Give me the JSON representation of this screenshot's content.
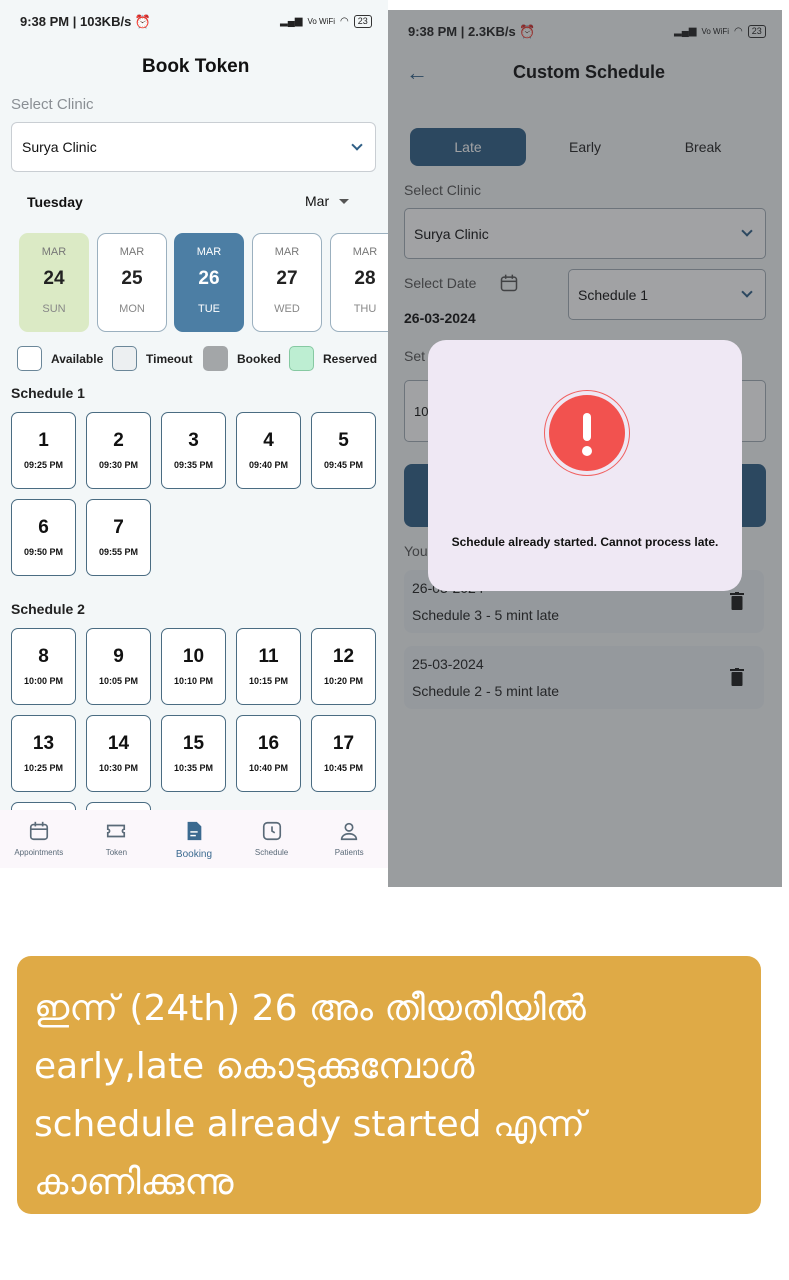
{
  "left_screen": {
    "status": {
      "time": "9:38 PM | 103KB/s ⏰",
      "signal": "Vo WiFi",
      "battery": "23"
    },
    "title": "Book Token",
    "select_clinic_label": "Select Clinic",
    "clinic_value": "Surya Clinic",
    "day_name": "Tuesday",
    "month_value": "Mar",
    "days": [
      {
        "month": "MAR",
        "date": "24",
        "weekday": "SUN"
      },
      {
        "month": "MAR",
        "date": "25",
        "weekday": "MON"
      },
      {
        "month": "MAR",
        "date": "26",
        "weekday": "TUE"
      },
      {
        "month": "MAR",
        "date": "27",
        "weekday": "WED"
      },
      {
        "month": "MAR",
        "date": "28",
        "weekday": "THU"
      }
    ],
    "legend": [
      {
        "label": "Available",
        "color": "#ffffff"
      },
      {
        "label": "Timeout",
        "color": "#eceff1"
      },
      {
        "label": "Booked",
        "color": "#a3a6a8"
      },
      {
        "label": "Reserved",
        "color": "#bdeed2"
      }
    ],
    "schedule1": {
      "title": "Schedule 1",
      "tokens": [
        {
          "num": "1",
          "time": "09:25 PM"
        },
        {
          "num": "2",
          "time": "09:30 PM"
        },
        {
          "num": "3",
          "time": "09:35 PM"
        },
        {
          "num": "4",
          "time": "09:40 PM"
        },
        {
          "num": "5",
          "time": "09:45 PM"
        },
        {
          "num": "6",
          "time": "09:50 PM"
        },
        {
          "num": "7",
          "time": "09:55 PM"
        }
      ]
    },
    "schedule2": {
      "title": "Schedule 2",
      "tokens": [
        {
          "num": "8",
          "time": "10:00 PM"
        },
        {
          "num": "9",
          "time": "10:05 PM"
        },
        {
          "num": "10",
          "time": "10:10 PM"
        },
        {
          "num": "11",
          "time": "10:15 PM"
        },
        {
          "num": "12",
          "time": "10:20 PM"
        },
        {
          "num": "13",
          "time": "10:25 PM"
        },
        {
          "num": "14",
          "time": "10:30 PM"
        },
        {
          "num": "15",
          "time": "10:35 PM"
        },
        {
          "num": "16",
          "time": "10:40 PM"
        },
        {
          "num": "17",
          "time": "10:45 PM"
        }
      ]
    },
    "nav": [
      {
        "label": "Appointments",
        "icon": "calendar-icon"
      },
      {
        "label": "Token",
        "icon": "ticket-icon"
      },
      {
        "label": "Booking",
        "icon": "document-icon"
      },
      {
        "label": "Schedule",
        "icon": "clock-icon"
      },
      {
        "label": "Patients",
        "icon": "person-icon"
      }
    ]
  },
  "right_screen": {
    "status": {
      "time": "9:38 PM | 2.3KB/s ⏰",
      "signal": "Vo WiFi",
      "battery": "23"
    },
    "title": "Custom Schedule",
    "tabs": [
      "Late",
      "Early",
      "Break"
    ],
    "select_clinic_label": "Select Clinic",
    "clinic_value": "Surya Clinic",
    "select_date_label": "Select Date",
    "date_value": "26-03-2024",
    "schedule_value": "Schedule 1",
    "set_label_partial": "Set",
    "set_input_partial": "10",
    "your_label_partial": "You",
    "entries": [
      {
        "date": "26-03-2024",
        "desc": "Schedule 3 - 5 mint late"
      },
      {
        "date": "25-03-2024",
        "desc": "Schedule 2 - 5 mint late"
      }
    ],
    "dialog_message": "Schedule already started. Cannot process late."
  },
  "caption": {
    "line1": "ഇന്ന് (24th) 26 അം തീയതിയിൽ",
    "line2": "early,late കൊടുക്കുമ്പോൾ",
    "line3": "schedule already started എന്ന്",
    "line4": "കാണിക്കുന്നു"
  },
  "colors": {
    "primary": "#2f5f86",
    "alert": "#f2524f",
    "caption_bg": "#dfaa46"
  }
}
